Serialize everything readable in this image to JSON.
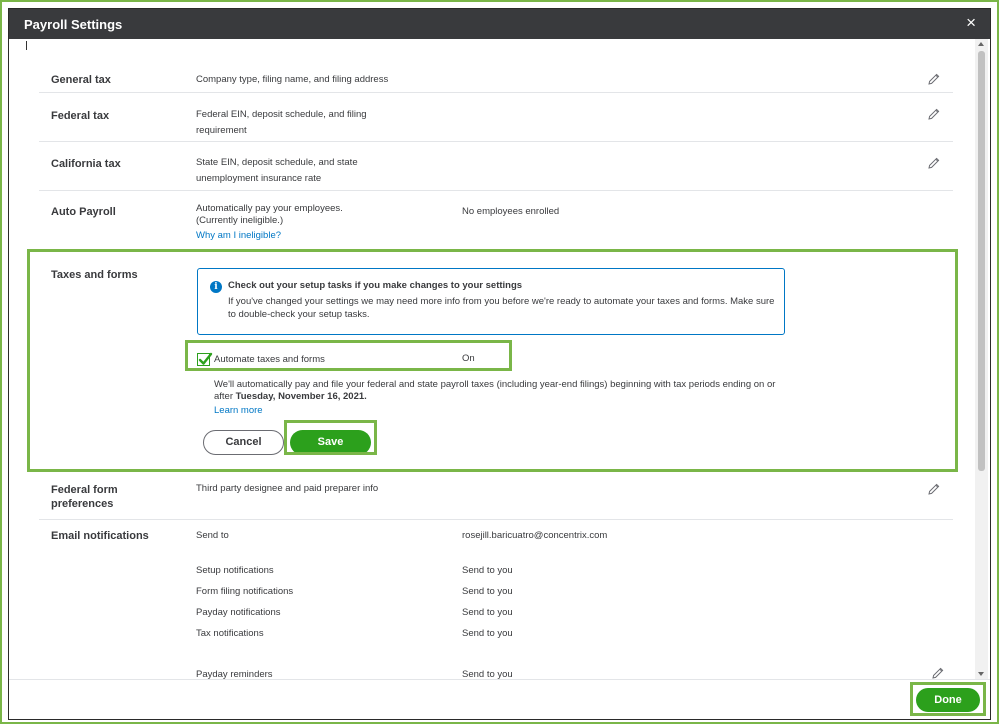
{
  "dialog": {
    "title": "Payroll Settings",
    "close_icon": "close-icon",
    "close_glyph": "×"
  },
  "sections": {
    "general_tax": {
      "label": "General tax",
      "description": "Company type, filing name, and filing address"
    },
    "federal_tax": {
      "label": "Federal tax",
      "description_line1": "Federal EIN, deposit schedule, and filing",
      "description_line2": "requirement"
    },
    "california_tax": {
      "label": "California tax",
      "description_line1": "State EIN, deposit schedule, and state",
      "description_line2": "unemployment insurance rate"
    },
    "auto_payroll": {
      "label": "Auto Payroll",
      "description_line1": "Automatically pay your employees.",
      "description_line2": "(Currently ineligible.)",
      "link": "Why am I ineligible?",
      "value": "No employees enrolled"
    },
    "taxes_and_forms": {
      "label": "Taxes and forms",
      "info_icon": "info-icon",
      "info_glyph": "i",
      "info_title": "Check out your setup tasks if you make changes to your settings",
      "info_text": "If you've changed your settings we may need more info from you before we're ready to automate your taxes and forms. Make sure to double-check your setup tasks.",
      "checkbox_label": "Automate taxes and forms",
      "checkbox_checked": true,
      "checkbox_value": "On",
      "auto_text_prefix": "We'll automatically pay and file your federal and state payroll taxes (including year-end filings) beginning with tax periods ending on or after ",
      "auto_text_date": "Tuesday, November 16, 2021.",
      "learn_more": "Learn more",
      "cancel_label": "Cancel",
      "save_label": "Save"
    },
    "federal_form_preferences": {
      "label_line1": "Federal form",
      "label_line2": "preferences",
      "description": "Third party designee and paid preparer info"
    },
    "email_notifications": {
      "label": "Email notifications",
      "rows": [
        {
          "name": "Send to",
          "value": "rosejill.baricuatro@concentrix.com"
        },
        {
          "name": "Setup notifications",
          "value": "Send to you"
        },
        {
          "name": "Form filing notifications",
          "value": "Send to you"
        },
        {
          "name": "Payday notifications",
          "value": "Send to you"
        },
        {
          "name": "Tax notifications",
          "value": "Send to you"
        },
        {
          "name": "Payday reminders",
          "value": "Send to you"
        }
      ]
    }
  },
  "footer": {
    "done_label": "Done"
  },
  "colors": {
    "accent_green": "#2ca01c",
    "highlight_green": "#7ab648",
    "link_blue": "#0077c5",
    "titlebar": "#393a3d"
  }
}
